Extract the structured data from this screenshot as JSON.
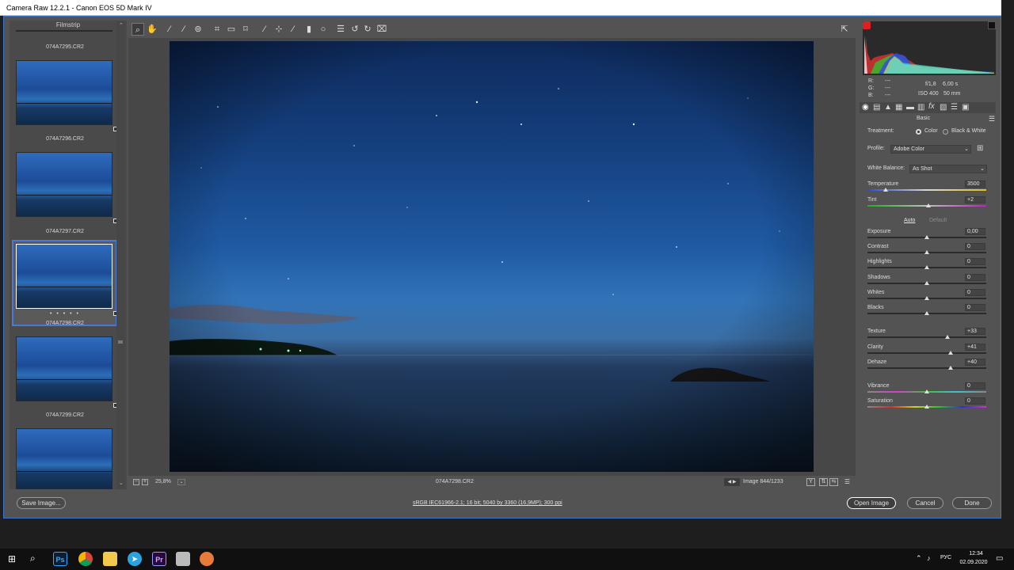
{
  "window": {
    "title": "Camera Raw 12.2.1  -  Canon EOS 5D Mark IV"
  },
  "filmstrip": {
    "header": "Filmstrip",
    "items": [
      {
        "name": "074A7295.CR2"
      },
      {
        "name": "074A7296.CR2"
      },
      {
        "name": "074A7297.CR2"
      },
      {
        "name": "074A7298.CR2",
        "selected": true,
        "rating": "• • • • •"
      },
      {
        "name": "074A7299.CR2"
      }
    ]
  },
  "toolbar": {
    "icons": [
      "zoom-icon",
      "hand-icon",
      "white-balance-icon",
      "color-sampler-icon",
      "targeted-adjustment-icon",
      "crop-icon",
      "straighten-icon",
      "transform-icon",
      "spot-removal-icon",
      "red-eye-icon",
      "adjustment-brush-icon",
      "graduated-filter-icon",
      "radial-filter-icon",
      "presets-icon",
      "rotate-left-icon",
      "rotate-right-icon",
      "delete-icon"
    ],
    "fullscreen_icon": "fullscreen-icon"
  },
  "status": {
    "zoom": "25,8%",
    "filename": "074A7298.CR2",
    "image_counter": "Image 844/1233"
  },
  "bottom": {
    "save_label": "Save Image...",
    "workflow_link": "sRGB IEC61966-2.1; 16 bit; 5040 by 3360 (16,9MP); 300 ppi",
    "open_label": "Open Image",
    "cancel_label": "Cancel",
    "done_label": "Done"
  },
  "info": {
    "r_label": "R:",
    "g_label": "G:",
    "b_label": "B:",
    "r_val": "---",
    "g_val": "---",
    "b_val": "---",
    "aperture": "f/1,8",
    "shutter": "6,00 s",
    "iso": "ISO 400",
    "focal": "50 mm"
  },
  "panel": {
    "title": "Basic",
    "treatment_label": "Treatment:",
    "color_label": "Color",
    "bw_label": "Black & White",
    "profile_label": "Profile:",
    "profile_value": "Adobe Color",
    "wb_label": "White Balance:",
    "wb_value": "As Shot",
    "auto_label": "Auto",
    "default_label": "Default",
    "sliders": [
      {
        "label": "Temperature",
        "value": "3500",
        "pos": 0.15
      },
      {
        "label": "Tint",
        "value": "+2",
        "pos": 0.51
      },
      {
        "label": "Exposure",
        "value": "0,00",
        "pos": 0.5
      },
      {
        "label": "Contrast",
        "value": "0",
        "pos": 0.5
      },
      {
        "label": "Highlights",
        "value": "0",
        "pos": 0.5
      },
      {
        "label": "Shadows",
        "value": "0",
        "pos": 0.5
      },
      {
        "label": "Whites",
        "value": "0",
        "pos": 0.5
      },
      {
        "label": "Blacks",
        "value": "0",
        "pos": 0.5
      },
      {
        "label": "Texture",
        "value": "+33",
        "pos": 0.67
      },
      {
        "label": "Clarity",
        "value": "+41",
        "pos": 0.7
      },
      {
        "label": "Dehaze",
        "value": "+40",
        "pos": 0.7
      },
      {
        "label": "Vibrance",
        "value": "0",
        "pos": 0.5
      },
      {
        "label": "Saturation",
        "value": "0",
        "pos": 0.5
      }
    ]
  },
  "taskbar": {
    "lang": "РУС",
    "time": "12:34",
    "date": "02.09.2020",
    "apps": [
      "Ps",
      "Pr"
    ]
  }
}
